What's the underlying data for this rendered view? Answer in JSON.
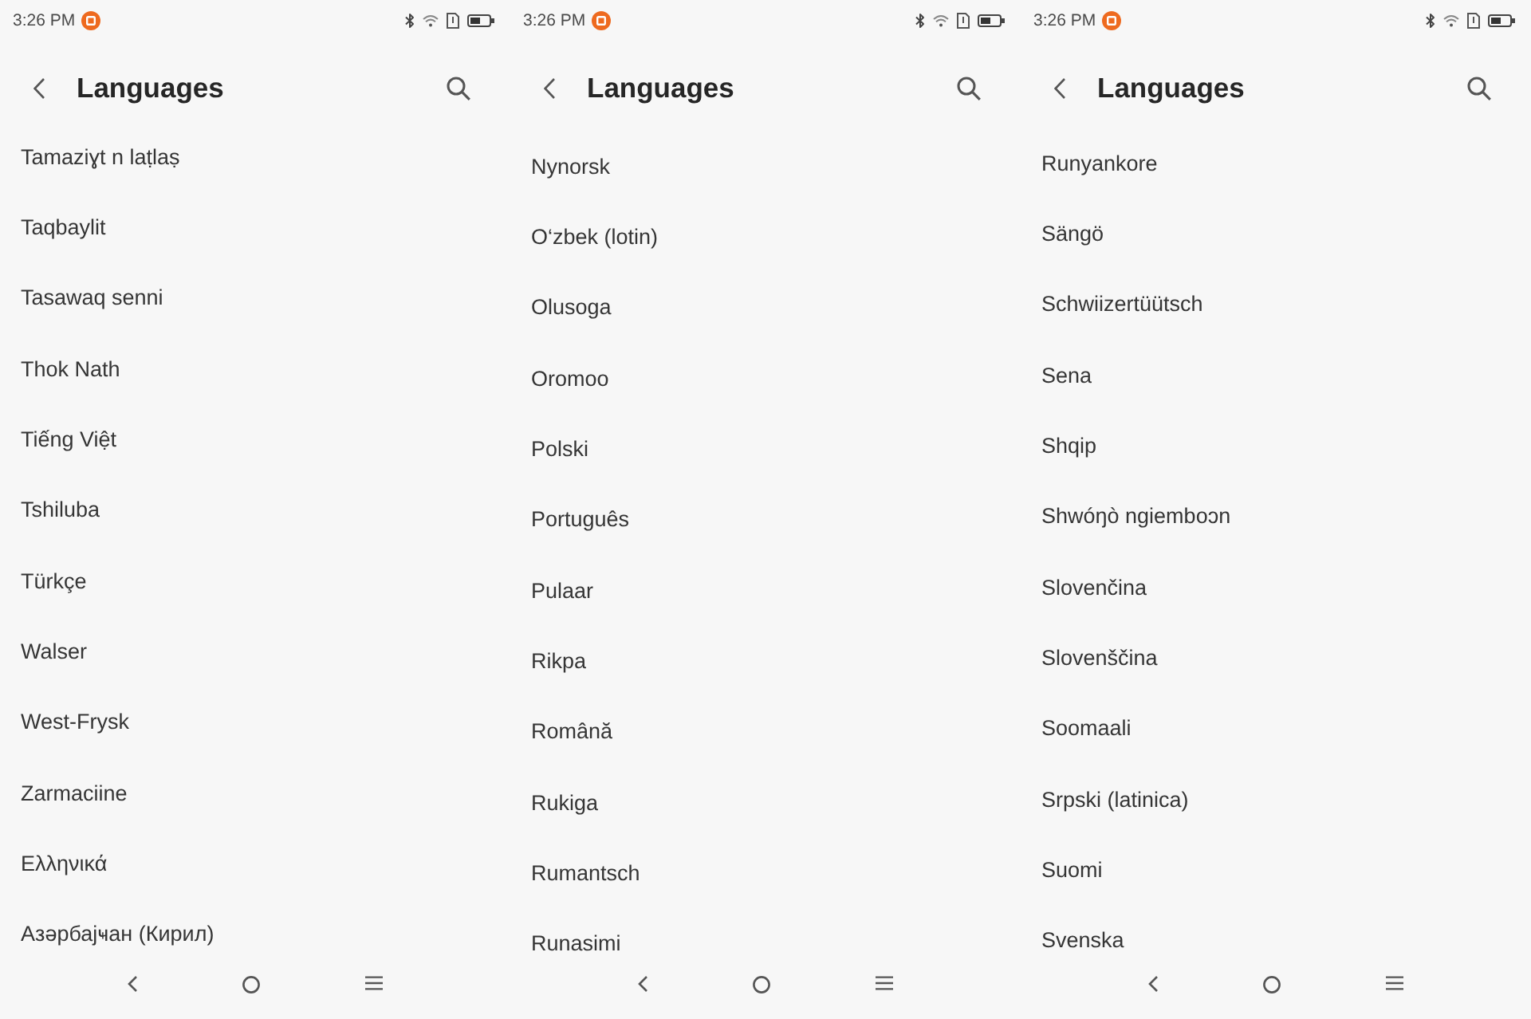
{
  "screens": [
    {
      "status_bar": {
        "time": "3:26 PM"
      },
      "header": {
        "title": "Languages"
      },
      "languages": [
        "Tamaziɣt n laṭlaṣ",
        "Taqbaylit",
        "Tasawaq senni",
        "Thok Nath",
        "Tiếng Việt",
        "Tshiluba",
        "Türkçe",
        "Walser",
        "West-Frysk",
        "Zarmaciine",
        "Ελληνικά",
        "Азәрбајҹан (Кирил)"
      ]
    },
    {
      "status_bar": {
        "time": "3:26 PM"
      },
      "header": {
        "title": "Languages"
      },
      "languages": [
        "Nynorsk",
        "O‘zbek (lotin)",
        "Olusoga",
        "Oromoo",
        "Polski",
        "Português",
        "Pulaar",
        "Rikpa",
        "Română",
        "Rukiga",
        "Rumantsch",
        "Runasimi"
      ]
    },
    {
      "status_bar": {
        "time": "3:26 PM"
      },
      "header": {
        "title": "Languages"
      },
      "languages": [
        "Runyankore",
        "Sängö",
        "Schwiizertüütsch",
        "Sena",
        "Shqip",
        "Shwóŋò ngiemboɔn",
        "Slovenčina",
        "Slovenščina",
        "Soomaali",
        "Srpski (latinica)",
        "Suomi",
        "Svenska"
      ]
    }
  ]
}
